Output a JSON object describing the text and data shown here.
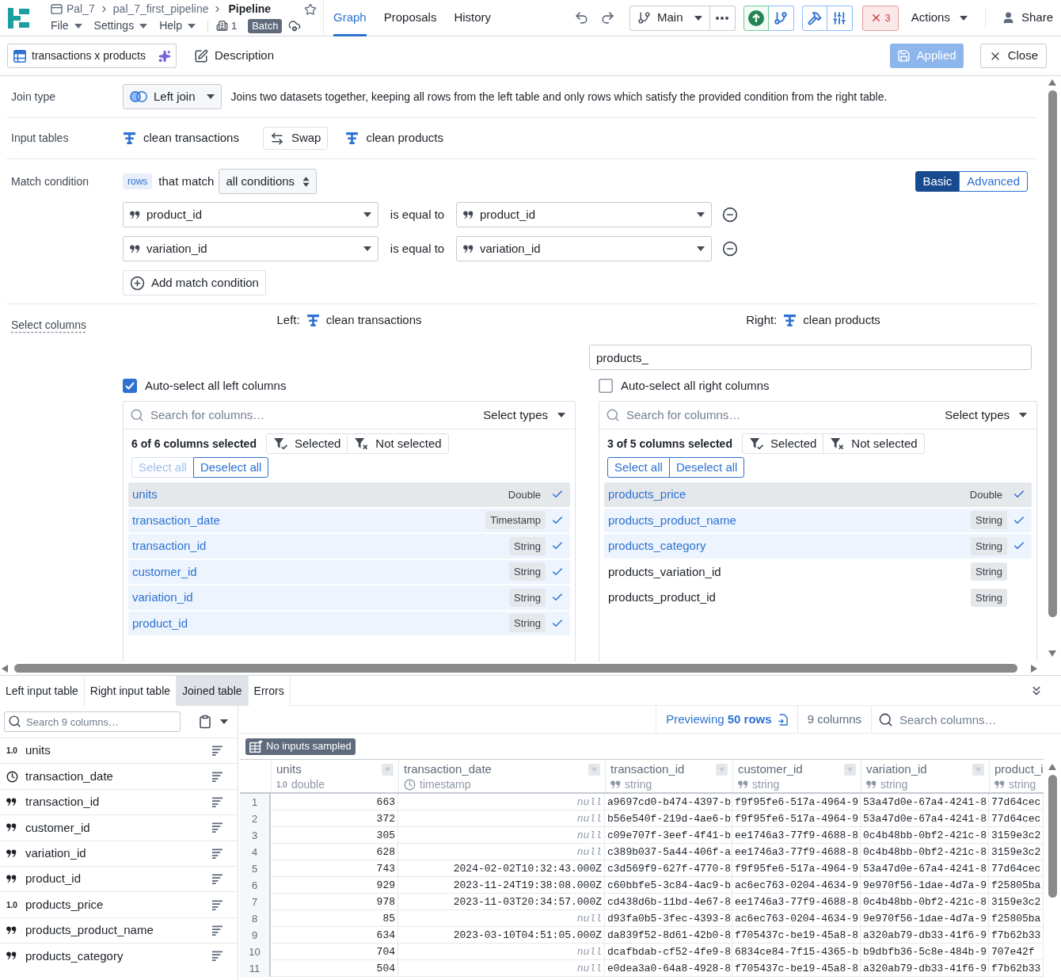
{
  "header": {
    "crumbs": [
      "Pal_7",
      "pal_7_first_pipeline"
    ],
    "title": "Pipeline",
    "menus": [
      "File",
      "Settings",
      "Help"
    ],
    "count": "1",
    "mode": "Batch",
    "tabs": [
      {
        "label": "Graph",
        "selected": true
      },
      {
        "label": "Proposals",
        "selected": false
      },
      {
        "label": "History",
        "selected": false
      }
    ],
    "branch": "Main",
    "errors": "3",
    "actions": "Actions",
    "share": "Share"
  },
  "toolbar": {
    "name": "transactions x products",
    "description": "Description",
    "apply": {
      "label": "Applied",
      "disabled": true
    },
    "close": "Close"
  },
  "join_type": {
    "label": "Join type",
    "value": "Left join",
    "description": "Joins two datasets together, keeping all rows from the left table and only rows which satisfy the provided condition from the right table."
  },
  "input_tables": {
    "label": "Input tables",
    "left": "clean transactions",
    "swap": "Swap",
    "right": "clean products"
  },
  "match_condition": {
    "label": "Match condition",
    "scope": "rows",
    "connector": "that match",
    "mode": "all conditions",
    "editor": [
      {
        "label": "Basic",
        "selected": true
      },
      {
        "label": "Advanced",
        "selected": false
      }
    ],
    "conditions": [
      {
        "left": "product_id",
        "operator": "is equal to",
        "right": "product_id"
      },
      {
        "left": "variation_id",
        "operator": "is equal to",
        "right": "variation_id"
      }
    ],
    "add": "Add match condition"
  },
  "select_columns": {
    "label": "Select columns",
    "left": {
      "heading": "Left:",
      "table": "clean transactions",
      "auto_select": {
        "label": "Auto-select all left columns",
        "checked": true
      },
      "search": {
        "placeholder": "Search for columns…"
      },
      "types": "Select types",
      "summary": "6 of 6 columns selected",
      "filters": [
        {
          "label": "Selected",
          "kind": "include"
        },
        {
          "label": "Not selected",
          "kind": "exclude"
        }
      ],
      "bulk": [
        {
          "label": "Select all",
          "disabled": true
        },
        {
          "label": "Deselect all",
          "disabled": false
        }
      ],
      "columns": [
        {
          "name": "units",
          "type": "Double",
          "selected": true,
          "highlighted": true
        },
        {
          "name": "transaction_date",
          "type": "Timestamp",
          "selected": true,
          "highlighted": false
        },
        {
          "name": "transaction_id",
          "type": "String",
          "selected": true,
          "highlighted": false
        },
        {
          "name": "customer_id",
          "type": "String",
          "selected": true,
          "highlighted": false
        },
        {
          "name": "variation_id",
          "type": "String",
          "selected": true,
          "highlighted": false
        },
        {
          "name": "product_id",
          "type": "String",
          "selected": true,
          "highlighted": false
        }
      ]
    },
    "right": {
      "heading": "Right:",
      "table": "clean products",
      "prefix": {
        "value": "products_"
      },
      "auto_select": {
        "label": "Auto-select all right columns",
        "checked": false
      },
      "search": {
        "placeholder": "Search for columns…"
      },
      "types": "Select types",
      "summary": "3 of 5 columns selected",
      "filters": [
        {
          "label": "Selected",
          "kind": "include"
        },
        {
          "label": "Not selected",
          "kind": "exclude"
        }
      ],
      "bulk": [
        {
          "label": "Select all",
          "disabled": false
        },
        {
          "label": "Deselect all",
          "disabled": false
        }
      ],
      "columns": [
        {
          "name": "products_price",
          "type": "Double",
          "selected": true,
          "highlighted": true
        },
        {
          "name": "products_product_name",
          "type": "String",
          "selected": true,
          "highlighted": false
        },
        {
          "name": "products_category",
          "type": "String",
          "selected": true,
          "highlighted": false
        },
        {
          "name": "products_variation_id",
          "type": "String",
          "selected": false,
          "highlighted": false
        },
        {
          "name": "products_product_id",
          "type": "String",
          "selected": false,
          "highlighted": false
        }
      ]
    }
  },
  "preview": {
    "tabs": [
      {
        "label": "Left input table",
        "selected": false
      },
      {
        "label": "Right input table",
        "selected": false
      },
      {
        "label": "Joined table",
        "selected": true
      },
      {
        "label": "Errors",
        "selected": false
      }
    ],
    "column_search": {
      "placeholder": "Search 9 columns…"
    },
    "columns": [
      {
        "name": "units",
        "kind": "double",
        "marker": "1.0"
      },
      {
        "name": "transaction_date",
        "kind": "timestamp"
      },
      {
        "name": "transaction_id",
        "kind": "string"
      },
      {
        "name": "customer_id",
        "kind": "string"
      },
      {
        "name": "variation_id",
        "kind": "string"
      },
      {
        "name": "product_id",
        "kind": "string"
      },
      {
        "name": "products_price",
        "kind": "double",
        "marker": "1.0"
      },
      {
        "name": "products_product_name",
        "kind": "string"
      },
      {
        "name": "products_category",
        "kind": "string"
      }
    ],
    "rows_link": "Previewing **50 rows**",
    "column_count": "9 columns",
    "search": {
      "placeholder": "Search columns…"
    },
    "sample_badge": "No inputs sampled",
    "table": {
      "columns": [
        {
          "name": "units",
          "kind": "double",
          "marker": "1.0",
          "type": "double"
        },
        {
          "name": "transaction_date",
          "kind": "timestamp",
          "type": "timestamp"
        },
        {
          "name": "transaction_id",
          "kind": "string",
          "type": "string"
        },
        {
          "name": "customer_id",
          "kind": "string",
          "type": "string"
        },
        {
          "name": "variation_id",
          "kind": "string",
          "type": "string"
        },
        {
          "name": "product_i",
          "kind": "string",
          "type": "string"
        }
      ],
      "rows": [
        {
          "number": "1",
          "cells": [
            "663",
            {
              "text": "null",
              "kind": "null"
            },
            "a9697cd0-b474-4397-b",
            "f9f95fe6-517a-4964-9",
            "53a47d0e-67a4-4241-8",
            "77d64cec"
          ]
        },
        {
          "number": "2",
          "cells": [
            "372",
            {
              "text": "null",
              "kind": "null"
            },
            "b56e540f-219d-4ae6-b",
            "f9f95fe6-517a-4964-9",
            "53a47d0e-67a4-4241-8",
            "77d64cec"
          ]
        },
        {
          "number": "3",
          "cells": [
            "305",
            {
              "text": "null",
              "kind": "null"
            },
            "c09e707f-3eef-4f41-b",
            "ee1746a3-77f9-4688-8",
            "0c4b48bb-0bf2-421c-8",
            "3159e3c2"
          ]
        },
        {
          "number": "4",
          "cells": [
            "628",
            {
              "text": "null",
              "kind": "null"
            },
            "c389b037-5a44-406f-a",
            "ee1746a3-77f9-4688-8",
            "0c4b48bb-0bf2-421c-8",
            "3159e3c2"
          ]
        },
        {
          "number": "5",
          "cells": [
            "743",
            "2024-02-02T10:32:43.000Z",
            "c3d569f9-627f-4770-8",
            "f9f95fe6-517a-4964-9",
            "53a47d0e-67a4-4241-8",
            "77d64cec"
          ]
        },
        {
          "number": "6",
          "cells": [
            "929",
            "2023-11-24T19:38:08.000Z",
            "c60bbfe5-3c84-4ac9-b",
            "ac6ec763-0204-4634-9",
            "9e970f56-1dae-4d7a-9",
            "f25805ba"
          ]
        },
        {
          "number": "7",
          "cells": [
            "978",
            "2023-11-03T20:34:57.000Z",
            "cd438d6b-11bd-4e67-8",
            "ee1746a3-77f9-4688-8",
            "0c4b48bb-0bf2-421c-8",
            "3159e3c2"
          ]
        },
        {
          "number": "8",
          "cells": [
            "85",
            {
              "text": "null",
              "kind": "null"
            },
            "d93fa0b5-3fec-4393-8",
            "ac6ec763-0204-4634-9",
            "9e970f56-1dae-4d7a-9",
            "f25805ba"
          ]
        },
        {
          "number": "9",
          "cells": [
            "634",
            "2023-03-10T04:51:05.000Z",
            "da839f52-8d61-42b0-8",
            "f705437c-be19-45a8-8",
            "a320ab79-db33-41f6-9",
            "f7b62b33"
          ]
        },
        {
          "number": "10",
          "cells": [
            "704",
            {
              "text": "null",
              "kind": "null"
            },
            "dcafbdab-cf52-4fe9-8",
            "6834ce84-7f15-4365-b",
            "b9dbfb36-5c8e-484b-9",
            "707e42f"
          ]
        },
        {
          "number": "11",
          "cells": [
            "504",
            {
              "text": "null",
              "kind": "null"
            },
            "e0dea3a0-64a8-4928-8",
            "f705437c-be19-45a8-8",
            "a320ab79-db33-41f6-9",
            "f7b62b33"
          ]
        }
      ]
    }
  }
}
